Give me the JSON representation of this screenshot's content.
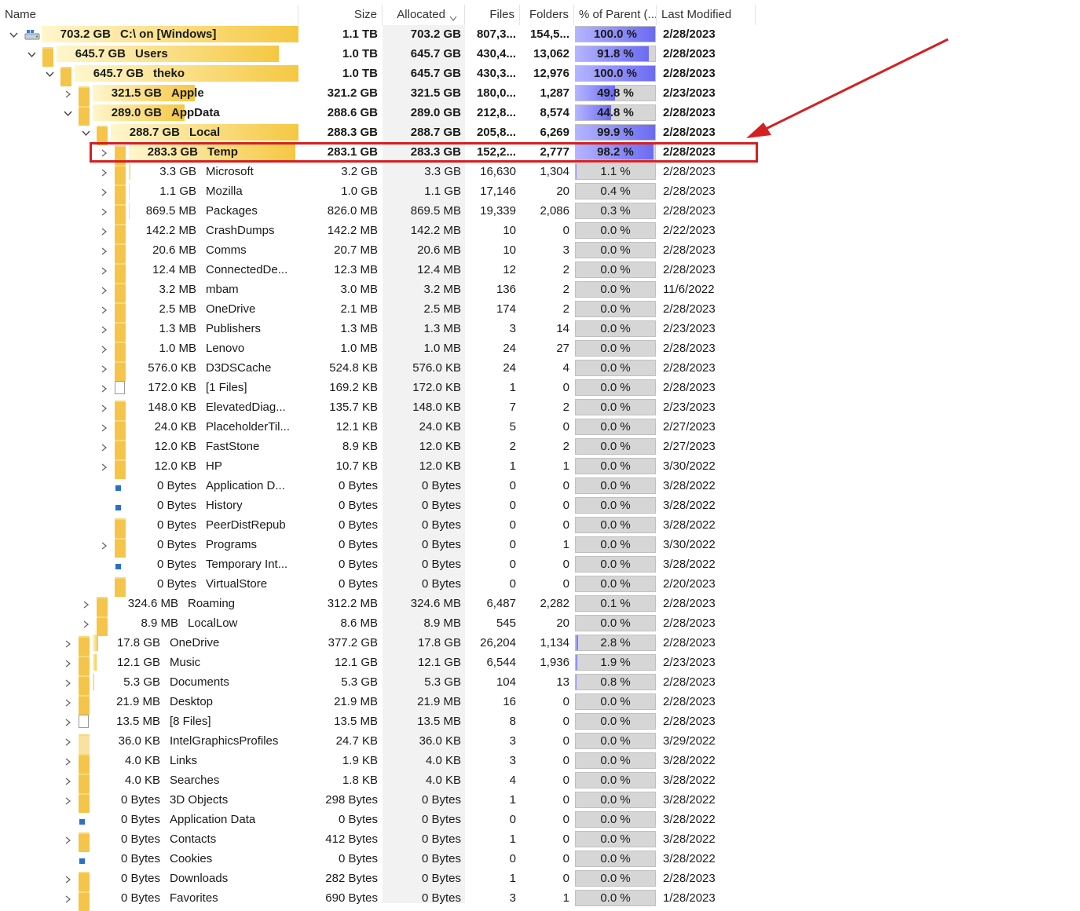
{
  "header": {
    "name": "Name",
    "size": "Size",
    "allocated": "Allocated",
    "files": "Files",
    "folders": "Folders",
    "pct": "% of Parent (...",
    "modified": "Last Modified"
  },
  "colors": {
    "size_bar": "#f5c842",
    "pct_fill": "#7b7bf5",
    "highlight": "#d42020"
  },
  "rows": [
    {
      "level": 0,
      "expanded": true,
      "icon": "drive",
      "bar": 1.0,
      "size": "703.2 GB",
      "name": "C:\\  on  [Windows]",
      "sz": "1.1 TB",
      "alloc": "703.2 GB",
      "files": "807,3...",
      "folders": "154,5...",
      "pct": "100.0 %",
      "pctv": 1.0,
      "mod": "2/28/2023",
      "bold": true
    },
    {
      "level": 1,
      "expanded": true,
      "icon": "folder",
      "bar": 0.918,
      "size": "645.7 GB",
      "name": "Users",
      "sz": "1.0 TB",
      "alloc": "645.7 GB",
      "files": "430,4...",
      "folders": "13,062",
      "pct": "91.8 %",
      "pctv": 0.918,
      "mod": "2/28/2023",
      "bold": true
    },
    {
      "level": 2,
      "expanded": true,
      "icon": "folder",
      "bar": 1.0,
      "size": "645.7 GB",
      "name": "theko",
      "sz": "1.0 TB",
      "alloc": "645.7 GB",
      "files": "430,3...",
      "folders": "12,976",
      "pct": "100.0 %",
      "pctv": 1.0,
      "mod": "2/28/2023",
      "bold": true
    },
    {
      "level": 3,
      "expanded": false,
      "icon": "folder",
      "bar": 0.498,
      "size": "321.5 GB",
      "name": "Apple",
      "sz": "321.2 GB",
      "alloc": "321.5 GB",
      "files": "180,0...",
      "folders": "1,287",
      "pct": "49.8 %",
      "pctv": 0.498,
      "mod": "2/23/2023",
      "bold": true
    },
    {
      "level": 3,
      "expanded": true,
      "icon": "folder",
      "bar": 0.448,
      "size": "289.0 GB",
      "name": "AppData",
      "sz": "288.6 GB",
      "alloc": "289.0 GB",
      "files": "212,8...",
      "folders": "8,574",
      "pct": "44.8 %",
      "pctv": 0.448,
      "mod": "2/28/2023",
      "bold": true
    },
    {
      "level": 4,
      "expanded": true,
      "icon": "folder",
      "bar": 0.999,
      "size": "288.7 GB",
      "name": "Local",
      "sz": "288.3 GB",
      "alloc": "288.7 GB",
      "files": "205,8...",
      "folders": "6,269",
      "pct": "99.9 %",
      "pctv": 0.999,
      "mod": "2/28/2023",
      "bold": true
    },
    {
      "level": 5,
      "expanded": false,
      "icon": "folder",
      "bar": 0.982,
      "size": "283.3 GB",
      "name": "Temp",
      "sz": "283.1 GB",
      "alloc": "283.3 GB",
      "files": "152,2...",
      "folders": "2,777",
      "pct": "98.2 %",
      "pctv": 0.982,
      "mod": "2/28/2023",
      "bold": true
    },
    {
      "level": 5,
      "expanded": false,
      "icon": "folder",
      "bar": 0.011,
      "size": "3.3 GB",
      "name": "Microsoft",
      "sz": "3.2 GB",
      "alloc": "3.3 GB",
      "files": "16,630",
      "folders": "1,304",
      "pct": "1.1 %",
      "pctv": 0.011,
      "mod": "2/28/2023"
    },
    {
      "level": 5,
      "expanded": false,
      "icon": "folder",
      "bar": 0.004,
      "size": "1.1 GB",
      "name": "Mozilla",
      "sz": "1.0 GB",
      "alloc": "1.1 GB",
      "files": "17,146",
      "folders": "20",
      "pct": "0.4 %",
      "pctv": 0.004,
      "mod": "2/28/2023"
    },
    {
      "level": 5,
      "expanded": false,
      "icon": "folder",
      "bar": 0.003,
      "size": "869.5 MB",
      "name": "Packages",
      "sz": "826.0 MB",
      "alloc": "869.5 MB",
      "files": "19,339",
      "folders": "2,086",
      "pct": "0.3 %",
      "pctv": 0.003,
      "mod": "2/28/2023"
    },
    {
      "level": 5,
      "expanded": false,
      "icon": "folder",
      "bar": 0,
      "size": "142.2 MB",
      "name": "CrashDumps",
      "sz": "142.2 MB",
      "alloc": "142.2 MB",
      "files": "10",
      "folders": "0",
      "pct": "0.0 %",
      "pctv": 0,
      "mod": "2/22/2023"
    },
    {
      "level": 5,
      "expanded": false,
      "icon": "folder",
      "bar": 0,
      "size": "20.6 MB",
      "name": "Comms",
      "sz": "20.7 MB",
      "alloc": "20.6 MB",
      "files": "10",
      "folders": "3",
      "pct": "0.0 %",
      "pctv": 0,
      "mod": "2/28/2023"
    },
    {
      "level": 5,
      "expanded": false,
      "icon": "folder",
      "bar": 0,
      "size": "12.4 MB",
      "name": "ConnectedDe...",
      "sz": "12.3 MB",
      "alloc": "12.4 MB",
      "files": "12",
      "folders": "2",
      "pct": "0.0 %",
      "pctv": 0,
      "mod": "2/28/2023"
    },
    {
      "level": 5,
      "expanded": false,
      "icon": "folder",
      "bar": 0,
      "size": "3.2 MB",
      "name": "mbam",
      "sz": "3.0 MB",
      "alloc": "3.2 MB",
      "files": "136",
      "folders": "2",
      "pct": "0.0 %",
      "pctv": 0,
      "mod": "11/6/2022"
    },
    {
      "level": 5,
      "expanded": false,
      "icon": "folder",
      "bar": 0,
      "size": "2.5 MB",
      "name": "OneDrive",
      "sz": "2.1 MB",
      "alloc": "2.5 MB",
      "files": "174",
      "folders": "2",
      "pct": "0.0 %",
      "pctv": 0,
      "mod": "2/28/2023"
    },
    {
      "level": 5,
      "expanded": false,
      "icon": "folder",
      "bar": 0,
      "size": "1.3 MB",
      "name": "Publishers",
      "sz": "1.3 MB",
      "alloc": "1.3 MB",
      "files": "3",
      "folders": "14",
      "pct": "0.0 %",
      "pctv": 0,
      "mod": "2/23/2023"
    },
    {
      "level": 5,
      "expanded": false,
      "icon": "folder",
      "bar": 0,
      "size": "1.0 MB",
      "name": "Lenovo",
      "sz": "1.0 MB",
      "alloc": "1.0 MB",
      "files": "24",
      "folders": "27",
      "pct": "0.0 %",
      "pctv": 0,
      "mod": "2/28/2023"
    },
    {
      "level": 5,
      "expanded": false,
      "icon": "folder",
      "bar": 0,
      "size": "576.0 KB",
      "name": "D3DSCache",
      "sz": "524.8 KB",
      "alloc": "576.0 KB",
      "files": "24",
      "folders": "4",
      "pct": "0.0 %",
      "pctv": 0,
      "mod": "2/28/2023"
    },
    {
      "level": 5,
      "expanded": false,
      "icon": "file",
      "bar": 0,
      "size": "172.0 KB",
      "name": "[1 Files]",
      "sz": "169.2 KB",
      "alloc": "172.0 KB",
      "files": "1",
      "folders": "0",
      "pct": "0.0 %",
      "pctv": 0,
      "mod": "2/28/2023"
    },
    {
      "level": 5,
      "expanded": false,
      "icon": "folder",
      "bar": 0,
      "size": "148.0 KB",
      "name": "ElevatedDiag...",
      "sz": "135.7 KB",
      "alloc": "148.0 KB",
      "files": "7",
      "folders": "2",
      "pct": "0.0 %",
      "pctv": 0,
      "mod": "2/23/2023"
    },
    {
      "level": 5,
      "expanded": false,
      "icon": "folder",
      "bar": 0,
      "size": "24.0 KB",
      "name": "PlaceholderTil...",
      "sz": "12.1 KB",
      "alloc": "24.0 KB",
      "files": "5",
      "folders": "0",
      "pct": "0.0 %",
      "pctv": 0,
      "mod": "2/27/2023"
    },
    {
      "level": 5,
      "expanded": false,
      "icon": "folder",
      "bar": 0,
      "size": "12.0 KB",
      "name": "FastStone",
      "sz": "8.9 KB",
      "alloc": "12.0 KB",
      "files": "2",
      "folders": "2",
      "pct": "0.0 %",
      "pctv": 0,
      "mod": "2/27/2023"
    },
    {
      "level": 5,
      "expanded": false,
      "icon": "folder",
      "bar": 0,
      "size": "12.0 KB",
      "name": "HP",
      "sz": "10.7 KB",
      "alloc": "12.0 KB",
      "files": "1",
      "folders": "1",
      "pct": "0.0 %",
      "pctv": 0,
      "mod": "3/30/2022"
    },
    {
      "level": 5,
      "expanded": null,
      "icon": "link",
      "bar": 0,
      "size": "0 Bytes",
      "name": "Application D...",
      "sz": "0 Bytes",
      "alloc": "0 Bytes",
      "files": "0",
      "folders": "0",
      "pct": "0.0 %",
      "pctv": 0,
      "mod": "3/28/2022"
    },
    {
      "level": 5,
      "expanded": null,
      "icon": "link",
      "bar": 0,
      "size": "0 Bytes",
      "name": "History",
      "sz": "0 Bytes",
      "alloc": "0 Bytes",
      "files": "0",
      "folders": "0",
      "pct": "0.0 %",
      "pctv": 0,
      "mod": "3/28/2022"
    },
    {
      "level": 5,
      "expanded": null,
      "icon": "folder",
      "bar": 0,
      "size": "0 Bytes",
      "name": "PeerDistRepub",
      "sz": "0 Bytes",
      "alloc": "0 Bytes",
      "files": "0",
      "folders": "0",
      "pct": "0.0 %",
      "pctv": 0,
      "mod": "3/28/2022"
    },
    {
      "level": 5,
      "expanded": false,
      "icon": "folder",
      "bar": 0,
      "size": "0 Bytes",
      "name": "Programs",
      "sz": "0 Bytes",
      "alloc": "0 Bytes",
      "files": "0",
      "folders": "1",
      "pct": "0.0 %",
      "pctv": 0,
      "mod": "3/30/2022"
    },
    {
      "level": 5,
      "expanded": null,
      "icon": "link",
      "bar": 0,
      "size": "0 Bytes",
      "name": "Temporary Int...",
      "sz": "0 Bytes",
      "alloc": "0 Bytes",
      "files": "0",
      "folders": "0",
      "pct": "0.0 %",
      "pctv": 0,
      "mod": "3/28/2022"
    },
    {
      "level": 5,
      "expanded": null,
      "icon": "folder",
      "bar": 0,
      "size": "0 Bytes",
      "name": "VirtualStore",
      "sz": "0 Bytes",
      "alloc": "0 Bytes",
      "files": "0",
      "folders": "0",
      "pct": "0.0 %",
      "pctv": 0,
      "mod": "2/20/2023"
    },
    {
      "level": 4,
      "expanded": false,
      "icon": "folder",
      "bar": 0.001,
      "size": "324.6 MB",
      "name": "Roaming",
      "sz": "312.2 MB",
      "alloc": "324.6 MB",
      "files": "6,487",
      "folders": "2,282",
      "pct": "0.1 %",
      "pctv": 0.001,
      "mod": "2/28/2023"
    },
    {
      "level": 4,
      "expanded": false,
      "icon": "folder",
      "bar": 0,
      "size": "8.9 MB",
      "name": "LocalLow",
      "sz": "8.6 MB",
      "alloc": "8.9 MB",
      "files": "545",
      "folders": "20",
      "pct": "0.0 %",
      "pctv": 0,
      "mod": "2/28/2023"
    },
    {
      "level": 3,
      "expanded": false,
      "icon": "folder",
      "bar": 0.028,
      "size": "17.8 GB",
      "name": "OneDrive",
      "sz": "377.2 GB",
      "alloc": "17.8 GB",
      "files": "26,204",
      "folders": "1,134",
      "pct": "2.8 %",
      "pctv": 0.028,
      "mod": "2/28/2023"
    },
    {
      "level": 3,
      "expanded": false,
      "icon": "folder",
      "bar": 0.019,
      "size": "12.1 GB",
      "name": "Music",
      "sz": "12.1 GB",
      "alloc": "12.1 GB",
      "files": "6,544",
      "folders": "1,936",
      "pct": "1.9 %",
      "pctv": 0.019,
      "mod": "2/23/2023"
    },
    {
      "level": 3,
      "expanded": false,
      "icon": "folder",
      "bar": 0.008,
      "size": "5.3 GB",
      "name": "Documents",
      "sz": "5.3 GB",
      "alloc": "5.3 GB",
      "files": "104",
      "folders": "13",
      "pct": "0.8 %",
      "pctv": 0.008,
      "mod": "2/28/2023"
    },
    {
      "level": 3,
      "expanded": false,
      "icon": "folder",
      "bar": 0,
      "size": "21.9 MB",
      "name": "Desktop",
      "sz": "21.9 MB",
      "alloc": "21.9 MB",
      "files": "16",
      "folders": "0",
      "pct": "0.0 %",
      "pctv": 0,
      "mod": "2/28/2023"
    },
    {
      "level": 3,
      "expanded": false,
      "icon": "file",
      "bar": 0,
      "size": "13.5 MB",
      "name": "[8 Files]",
      "sz": "13.5 MB",
      "alloc": "13.5 MB",
      "files": "8",
      "folders": "0",
      "pct": "0.0 %",
      "pctv": 0,
      "mod": "2/28/2023"
    },
    {
      "level": 3,
      "expanded": false,
      "icon": "folder-light",
      "bar": 0,
      "size": "36.0 KB",
      "name": "IntelGraphicsProfiles",
      "sz": "24.7 KB",
      "alloc": "36.0 KB",
      "files": "3",
      "folders": "0",
      "pct": "0.0 %",
      "pctv": 0,
      "mod": "3/29/2022"
    },
    {
      "level": 3,
      "expanded": false,
      "icon": "folder",
      "bar": 0,
      "size": "4.0 KB",
      "name": "Links",
      "sz": "1.9 KB",
      "alloc": "4.0 KB",
      "files": "3",
      "folders": "0",
      "pct": "0.0 %",
      "pctv": 0,
      "mod": "3/28/2022"
    },
    {
      "level": 3,
      "expanded": false,
      "icon": "folder",
      "bar": 0,
      "size": "4.0 KB",
      "name": "Searches",
      "sz": "1.8 KB",
      "alloc": "4.0 KB",
      "files": "4",
      "folders": "0",
      "pct": "0.0 %",
      "pctv": 0,
      "mod": "3/28/2022"
    },
    {
      "level": 3,
      "expanded": false,
      "icon": "folder",
      "bar": 0,
      "size": "0 Bytes",
      "name": "3D Objects",
      "sz": "298 Bytes",
      "alloc": "0 Bytes",
      "files": "1",
      "folders": "0",
      "pct": "0.0 %",
      "pctv": 0,
      "mod": "3/28/2022"
    },
    {
      "level": 3,
      "expanded": null,
      "icon": "link",
      "bar": 0,
      "size": "0 Bytes",
      "name": "Application Data",
      "sz": "0 Bytes",
      "alloc": "0 Bytes",
      "files": "0",
      "folders": "0",
      "pct": "0.0 %",
      "pctv": 0,
      "mod": "3/28/2022"
    },
    {
      "level": 3,
      "expanded": false,
      "icon": "folder",
      "bar": 0,
      "size": "0 Bytes",
      "name": "Contacts",
      "sz": "412 Bytes",
      "alloc": "0 Bytes",
      "files": "1",
      "folders": "0",
      "pct": "0.0 %",
      "pctv": 0,
      "mod": "3/28/2022"
    },
    {
      "level": 3,
      "expanded": null,
      "icon": "link",
      "bar": 0,
      "size": "0 Bytes",
      "name": "Cookies",
      "sz": "0 Bytes",
      "alloc": "0 Bytes",
      "files": "0",
      "folders": "0",
      "pct": "0.0 %",
      "pctv": 0,
      "mod": "3/28/2022"
    },
    {
      "level": 3,
      "expanded": false,
      "icon": "folder",
      "bar": 0,
      "size": "0 Bytes",
      "name": "Downloads",
      "sz": "282 Bytes",
      "alloc": "0 Bytes",
      "files": "1",
      "folders": "0",
      "pct": "0.0 %",
      "pctv": 0,
      "mod": "2/28/2023"
    },
    {
      "level": 3,
      "expanded": false,
      "icon": "folder",
      "bar": 0,
      "size": "0 Bytes",
      "name": "Favorites",
      "sz": "690 Bytes",
      "alloc": "0 Bytes",
      "files": "3",
      "folders": "1",
      "pct": "0.0 %",
      "pctv": 0,
      "mod": "1/28/2023"
    }
  ]
}
